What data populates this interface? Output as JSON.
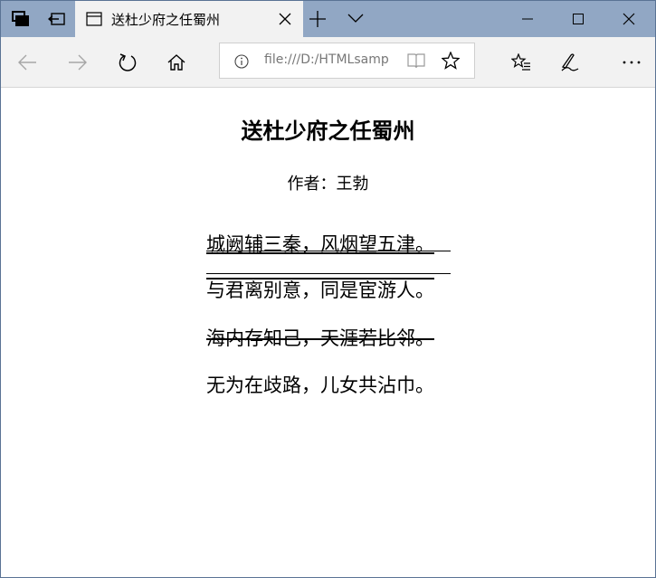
{
  "tab": {
    "title": "送杜少府之任蜀州"
  },
  "address": {
    "url": "file:///D:/HTMLsamp"
  },
  "poem": {
    "title": "送杜少府之任蜀州",
    "author": "作者：王勃",
    "lines": [
      "城阙辅三秦，风烟望五津。",
      "与君离别意，同是宦游人。",
      "海内存知己，天涯若比邻。",
      "无为在歧路，儿女共沾巾。"
    ]
  },
  "icons": {
    "tab_manager": "tab-manager-icon",
    "set_aside": "set-aside-tabs-icon",
    "page": "page-icon",
    "close_tab": "close-icon",
    "new_tab": "plus-icon",
    "tab_list": "chevron-down-icon",
    "minimize": "minimize-icon",
    "maximize": "maximize-icon",
    "close_window": "close-icon",
    "back": "arrow-left-icon",
    "forward": "arrow-right-icon",
    "refresh": "refresh-icon",
    "home": "home-icon",
    "info": "info-icon",
    "reading_view": "book-icon",
    "favorite": "star-icon",
    "favorites_hub": "favorites-list-icon",
    "notes": "pen-icon",
    "more": "more-icon"
  },
  "colors": {
    "titlebar": "#91a7c4",
    "toolbar": "#f2f2f2",
    "page_bg": "#ffffff",
    "text": "#000000"
  }
}
